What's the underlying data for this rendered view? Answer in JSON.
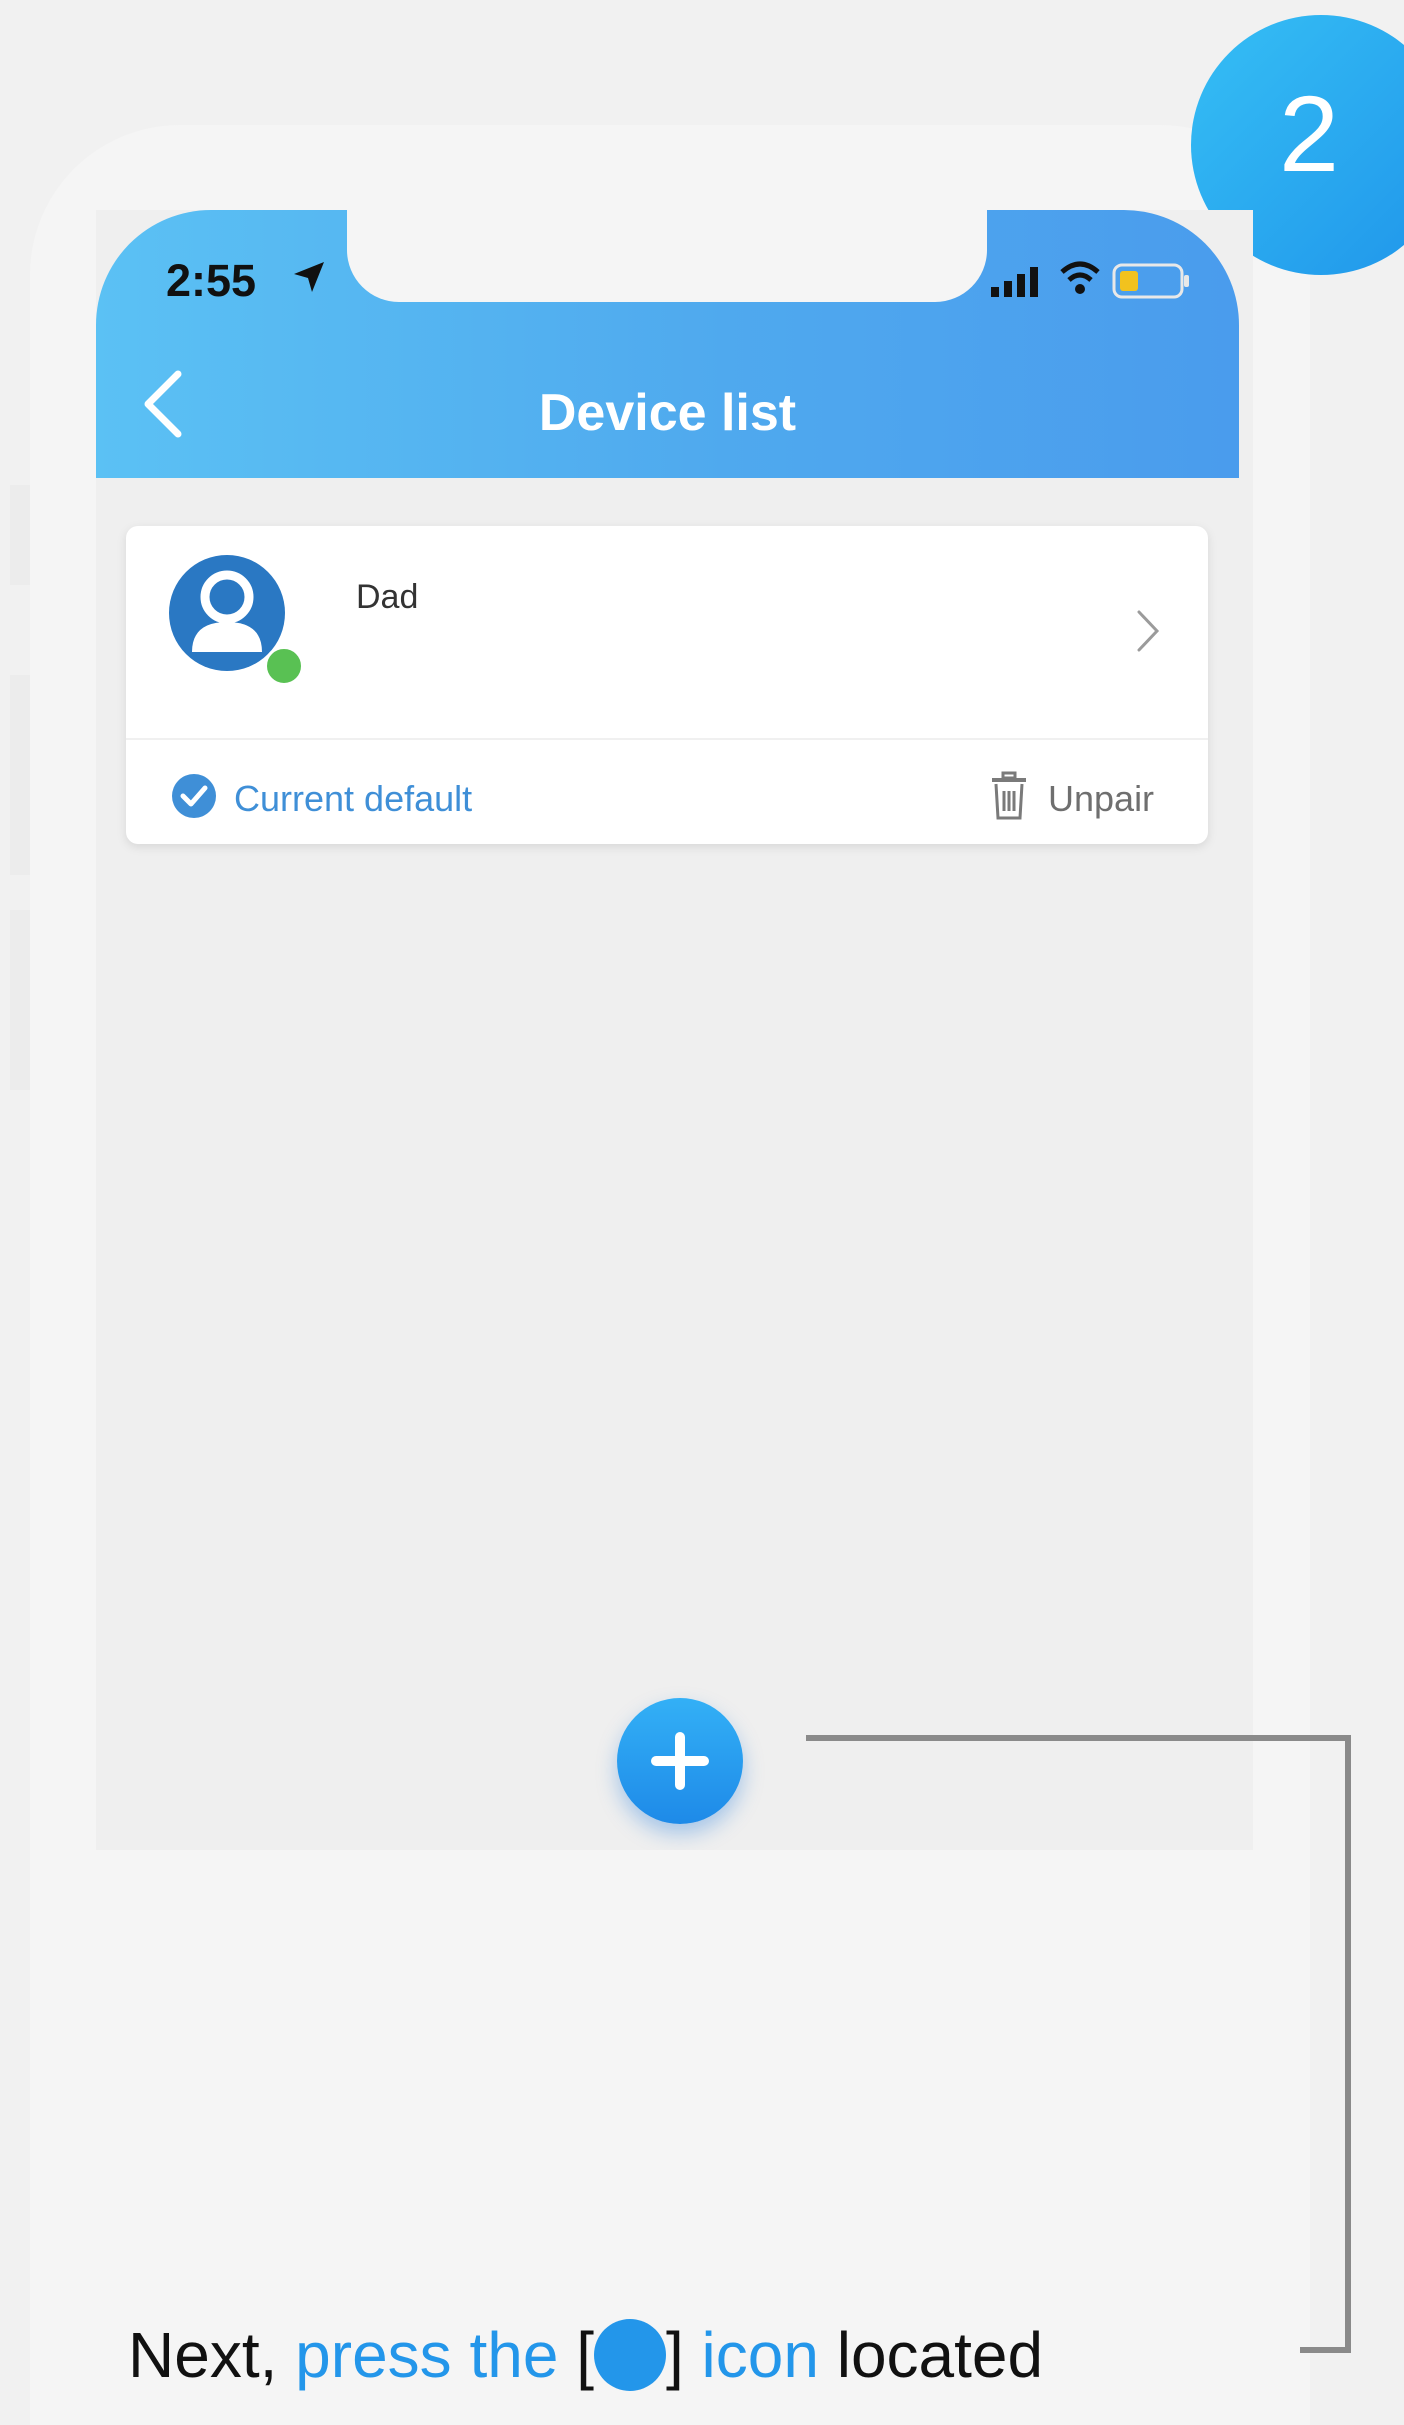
{
  "step": {
    "number": "2"
  },
  "status_bar": {
    "time": "2:55"
  },
  "header": {
    "title": "Device list"
  },
  "device_card": {
    "name": "Dad",
    "default_label": "Current default",
    "unpair_label": "Unpair"
  },
  "instruction": {
    "part1": "Next, ",
    "highlight1": "press the",
    "bracket_open": " [",
    "bracket_close": "] ",
    "highlight2": "icon",
    "part2": " located"
  },
  "colors": {
    "appbar_start": "#5bc1f4",
    "appbar_end": "#4a9ced",
    "accent_blue": "#2396ea",
    "online_green": "#59c153"
  },
  "icons": [
    "location-arrow-icon",
    "signal-icon",
    "wifi-icon",
    "battery-icon",
    "back-icon",
    "avatar-icon",
    "chevron-right-icon",
    "check-circle-icon",
    "trash-icon",
    "plus-icon"
  ]
}
